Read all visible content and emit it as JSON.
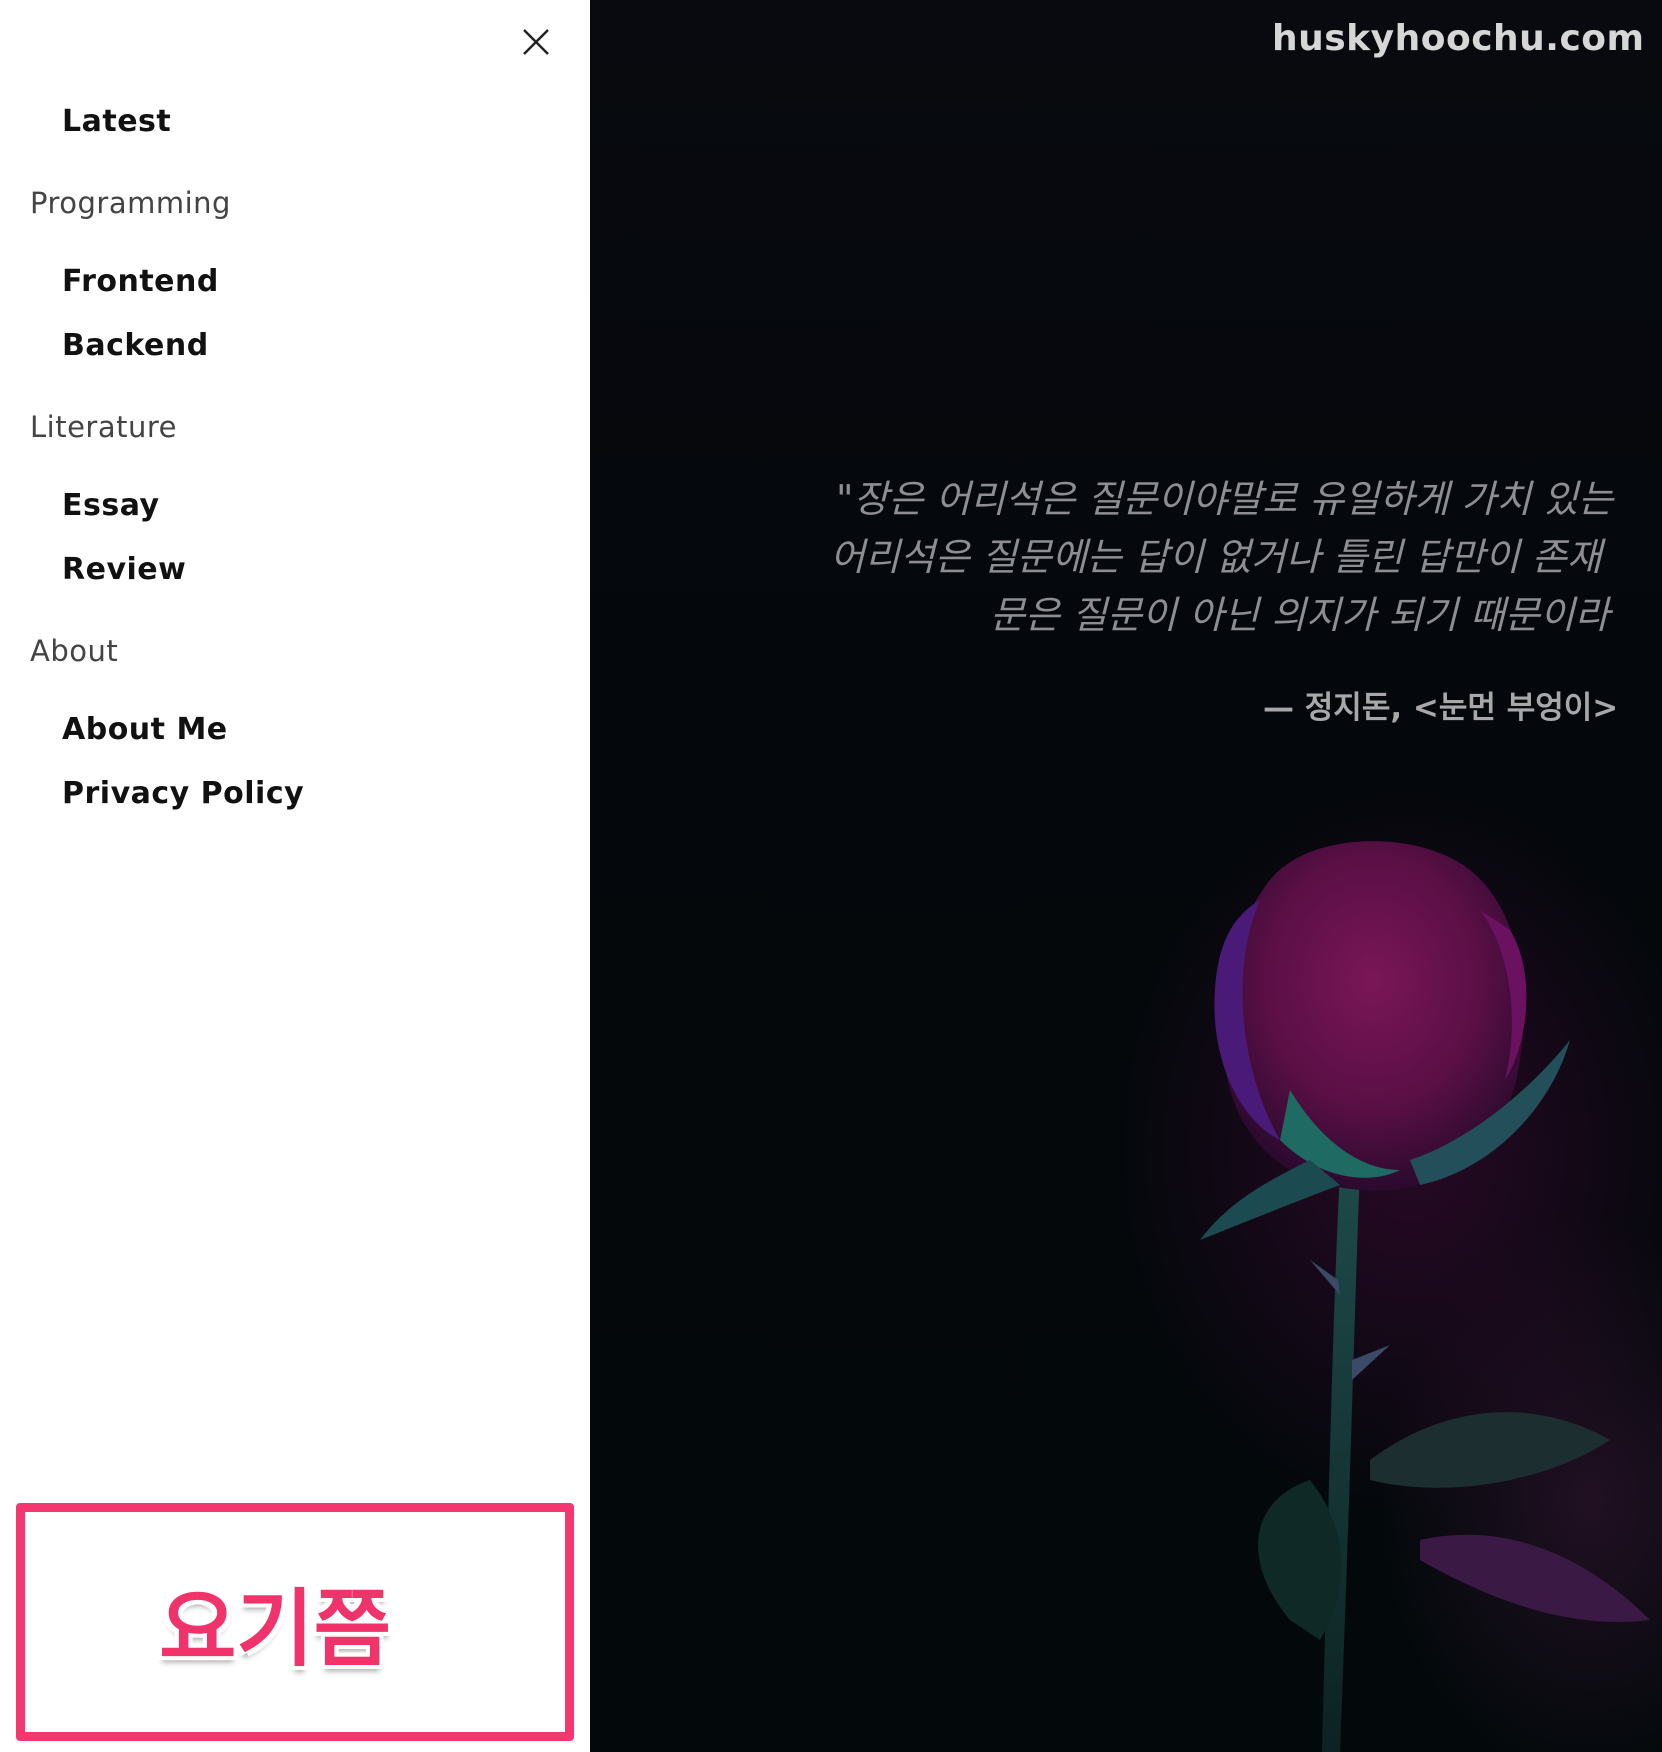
{
  "site": {
    "title": "huskyhoochu.com"
  },
  "hero": {
    "quote_lines": [
      "\"장은 어리석은 질문이야말로 유일하게 가치 있는",
      "어리석은 질문에는 답이 없거나 틀린 답만이 존재",
      "문은 질문이 아닌 의지가 되기 때문이라"
    ],
    "quote_author": "— 정지돈, <눈먼 부엉이>"
  },
  "drawer": {
    "close_icon": "close-icon",
    "items": [
      {
        "type": "link",
        "label": "Latest"
      },
      {
        "type": "section",
        "label": "Programming"
      },
      {
        "type": "link",
        "label": "Frontend"
      },
      {
        "type": "link",
        "label": "Backend"
      },
      {
        "type": "section",
        "label": "Literature"
      },
      {
        "type": "link",
        "label": "Essay"
      },
      {
        "type": "link",
        "label": "Review"
      },
      {
        "type": "section",
        "label": "About"
      },
      {
        "type": "link",
        "label": "About Me"
      },
      {
        "type": "link",
        "label": "Privacy Policy"
      }
    ]
  },
  "annotation": {
    "label": "요기쯤",
    "color": "#f0336b"
  },
  "colors": {
    "drawer_bg": "#ffffff",
    "hero_bg": "#05080c",
    "accent": "#f4376f"
  }
}
